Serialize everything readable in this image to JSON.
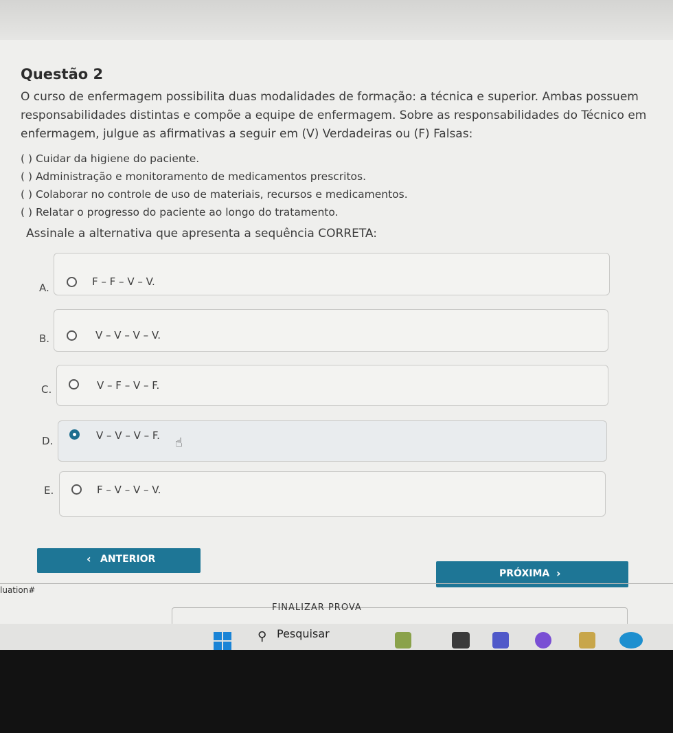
{
  "question": {
    "title": "Questão 2",
    "text_lines": [
      "O curso de enfermagem possibilita duas modalidades de formação: a técnica e superior. Ambas possuem",
      "responsabilidades distintas e compõe a equipe de enfermagem. Sobre as responsabilidades do Técnico em",
      "enfermagem, julgue as afirmativas a seguir em (V) Verdadeiras ou (F) Falsas:"
    ],
    "statements": [
      "( ) Cuidar da higiene do paciente.",
      "( ) Administração e monitoramento de medicamentos prescritos.",
      "( ) Colaborar no controle de uso de materiais, recursos e medicamentos.",
      "( ) Relatar o progresso do paciente ao longo do tratamento."
    ],
    "instruction": "Assinale a alternativa que apresenta a sequência CORRETA:"
  },
  "options": [
    {
      "letter": "A.",
      "text": "F – F – V – V.",
      "selected": false
    },
    {
      "letter": "B.",
      "text": "V – V – V – V.",
      "selected": false
    },
    {
      "letter": "C.",
      "text": "V – F – V – F.",
      "selected": false
    },
    {
      "letter": "D.",
      "text": "V – V – V – F.",
      "selected": true
    },
    {
      "letter": "E.",
      "text": "F – V – V – V.",
      "selected": false
    }
  ],
  "nav": {
    "prev_label": "ANTERIOR",
    "next_label": "PRÓXIMA",
    "finish_label": "FINALIZAR PROVA"
  },
  "footer_fragment": "luation#",
  "taskbar": {
    "search_label": "Pesquisar"
  },
  "colors": {
    "accent": "#1e7696"
  }
}
